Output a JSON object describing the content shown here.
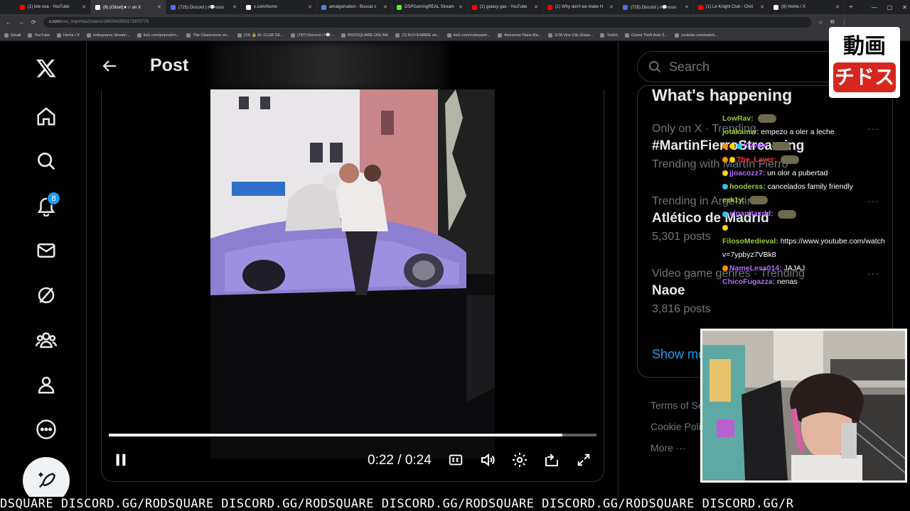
{
  "browser": {
    "tabs": [
      {
        "title": "(1) kite ova - YouTube",
        "color": "#ff0000"
      },
      {
        "title": "(8) (Gitsel)★☆ on X",
        "color": "#ffffff",
        "active": true
      },
      {
        "title": "(725) Discord | #💬vsso",
        "color": "#5865f2"
      },
      {
        "title": "x.com/home",
        "color": "#ffffff"
      },
      {
        "title": "amalgamation - Buscar c",
        "color": "#4285f4"
      },
      {
        "title": "DSPGamingREAL Stream",
        "color": "#53fc18"
      },
      {
        "title": "(1) galaxy gas - YouTube",
        "color": "#ff0000"
      },
      {
        "title": "(1) Why don't we make H",
        "color": "#ff0000"
      },
      {
        "title": "(725) Discord | #💬vsso",
        "color": "#5865f2"
      },
      {
        "title": "(1) Le Knight Club - Chiri",
        "color": "#ff0000"
      },
      {
        "title": "(8) Home / X",
        "color": "#ffffff"
      }
    ],
    "new_tab": "+",
    "url_host": "x.com",
    "url_path": "/eso_importaa2/status/1800042563172970779",
    "bookmarks": [
      "Gmail",
      "YouTube",
      "Home / X",
      "rodsquaree Stream...",
      "kick.com/popout/ro...",
      "The Classrooms en...",
      "(13) 🔒 EL CLUB DE...",
      "(787) Discord | #💬...",
      "RODSQUARE.ONLINE",
      "(2) NOVIEMBRE en...",
      "kick.com/rodsquare...",
      "Awesome-Nano-Ba...",
      "GTA Vice City (Espa...",
      "Twitch",
      "Grand Theft Auto 3...",
      "youtube.com/watch..."
    ]
  },
  "leftnav": {
    "notifications_count": "8",
    "icons": [
      "x-logo-icon",
      "home-icon",
      "explore-icon",
      "notifications-icon",
      "messages-icon",
      "grok-icon",
      "communities-icon",
      "profile-icon",
      "more-icon"
    ]
  },
  "main": {
    "header_title": "Post",
    "video": {
      "time": "0:22 / 0:24",
      "progress": 0.93
    }
  },
  "right": {
    "search_placeholder": "Search",
    "trends_heading": "What's happening",
    "trends": [
      {
        "context": "Only on X · Trending",
        "name": "#MartinFierroStreaming",
        "count": "Trending with Martín Fierro"
      },
      {
        "context": "Trending in Argentina",
        "name": "Atlético de Madrid",
        "count": "5,301 posts"
      },
      {
        "context": "Video game genres · Trending",
        "name": "Naoe",
        "count": "3,816 posts"
      }
    ],
    "show_more": "Show more",
    "footer": [
      "Terms of Service",
      "Cookie Policy",
      "More ···"
    ]
  },
  "overlay": {
    "logo_top": "動画",
    "logo_bottom": "チドス",
    "chat": [
      {
        "user": "LowRav:",
        "color": "#9acd32",
        "msg": "",
        "emote": true,
        "badges": []
      },
      {
        "user": "jotakamw:",
        "color": "#9acd32",
        "msg": "empezo a oler a leche",
        "emote": false,
        "badges": []
      },
      {
        "user": "Kyvaa:",
        "color": "#b06bff",
        "msg": "",
        "emote": true,
        "badges": [
          "#ff8c00",
          "#ffd400",
          "#2ec4f1"
        ]
      },
      {
        "user": "The_Layer:",
        "color": "#ff3030",
        "msg": "",
        "emote": true,
        "badges": [
          "#ff8c00",
          "#ffd400"
        ]
      },
      {
        "user": "jjoacozz7:",
        "color": "#b06bff",
        "msg": "un olor a pubertad",
        "emote": false,
        "badges": [
          "#ffd400"
        ]
      },
      {
        "user": "hooderss:",
        "color": "#9acd32",
        "msg": "cancelados family friendly",
        "emote": false,
        "badges": [
          "#2ec4f1"
        ]
      },
      {
        "user": "ezk1y:",
        "color": "#9acd32",
        "msg": "",
        "emote": true,
        "badges": []
      },
      {
        "user": "elpanitaxdd:",
        "color": "#b06bff",
        "msg": "",
        "emote": true,
        "badges": [
          "#2ec4f1"
        ]
      },
      {
        "user": "",
        "color": "#9acd32",
        "msg": "",
        "emote": false,
        "badges": [
          "#ffd400"
        ]
      },
      {
        "user": "FilosoMedieval:",
        "color": "#9acd32",
        "msg": "https://www.youtube.com/watch",
        "emote": false,
        "badges": []
      },
      {
        "user": "",
        "color": "#9acd32",
        "msg": "v=7ypbyz7VBk8",
        "emote": false,
        "badges": []
      },
      {
        "user": "NameLess014:",
        "color": "#b06bff",
        "msg": "JAJAJ",
        "emote": false,
        "badges": [
          "#ff8c00"
        ]
      },
      {
        "user": "ChicoFugazza:",
        "color": "#b06bff",
        "msg": "nenas",
        "emote": false,
        "badges": []
      }
    ],
    "ticker": "DSQUARE DISCORD.GG/RODSQUARE DISCORD.GG/RODSQUARE DISCORD.GG/RODSQUARE DISCORD.GG/RODSQUARE DISCORD.GG/R"
  },
  "colors": {
    "accent": "#1d9bf0",
    "border": "#2f3336",
    "muted": "#71767b"
  }
}
